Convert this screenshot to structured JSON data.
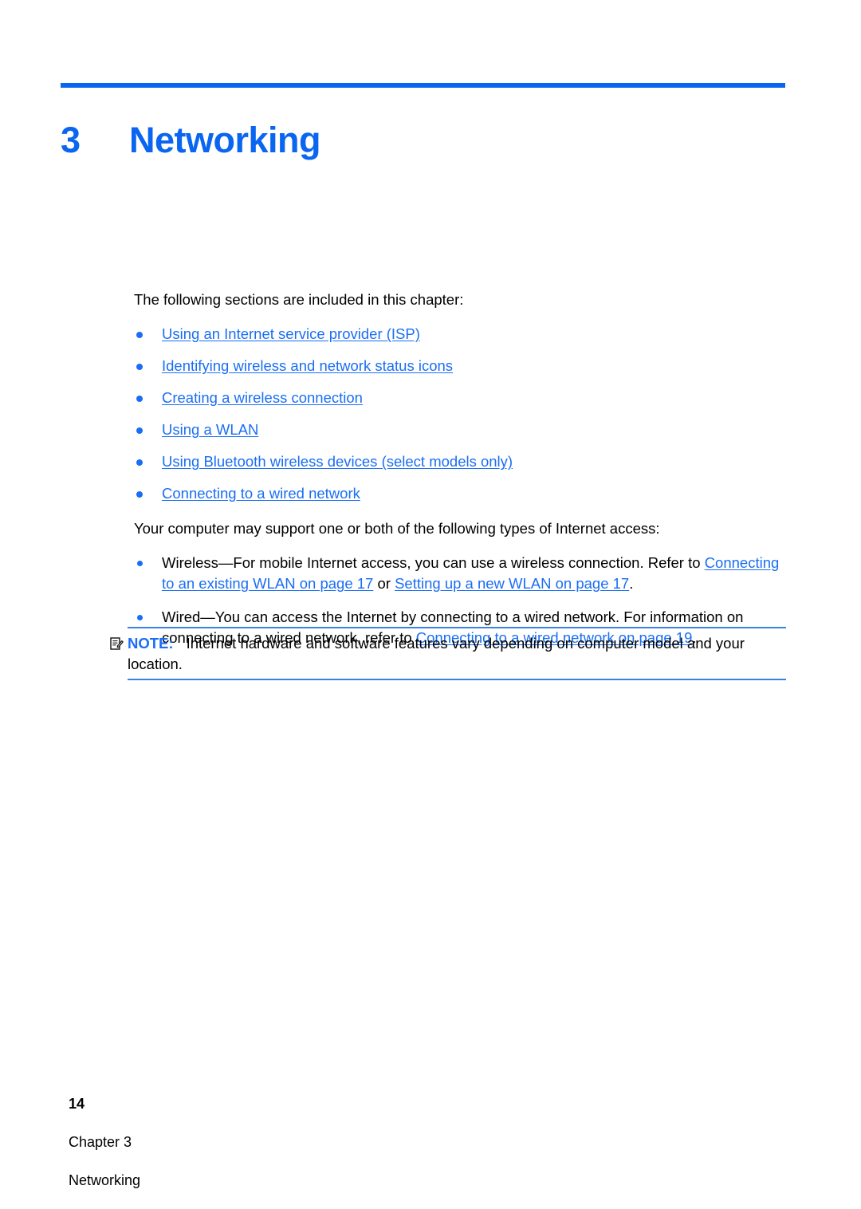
{
  "chapter": {
    "number": "3",
    "title": "Networking",
    "accent_color": "#0a66f0"
  },
  "intro": {
    "text": "The following sections are included in this chapter:"
  },
  "section_links": [
    {
      "label": "Using an Internet service provider (ISP)"
    },
    {
      "label": "Identifying wireless and network status icons"
    },
    {
      "label": "Creating a wireless connection"
    },
    {
      "label": "Using a WLAN"
    },
    {
      "label": "Using Bluetooth wireless devices (select models only)"
    },
    {
      "label": "Connecting to a wired network"
    }
  ],
  "access_intro": {
    "text": "Your computer may support one or both of the following types of Internet access:"
  },
  "access_types": [
    {
      "lead": "Wireless—For mobile Internet access, you can use a wireless connection. Refer to ",
      "link1": "Connecting to an existing WLAN on page 17",
      "mid": " or ",
      "link2": "Setting up a new WLAN on page 17",
      "tail": "."
    },
    {
      "lead": "Wired—You can access the Internet by connecting to a wired network. For information on connecting to a wired network, refer to ",
      "link1": "Connecting to a wired network on page 19",
      "mid": "",
      "link2": "",
      "tail": "."
    }
  ],
  "note": {
    "icon": "note-pencil-icon",
    "label": "NOTE:",
    "text": "Internet hardware and software features vary depending on computer model and your location.",
    "rule_color": "#3b82e8"
  },
  "footer": {
    "page_number": "14",
    "chapter_label": "Chapter 3",
    "chapter_title": "Networking"
  },
  "link_color": "#1a6ef5"
}
